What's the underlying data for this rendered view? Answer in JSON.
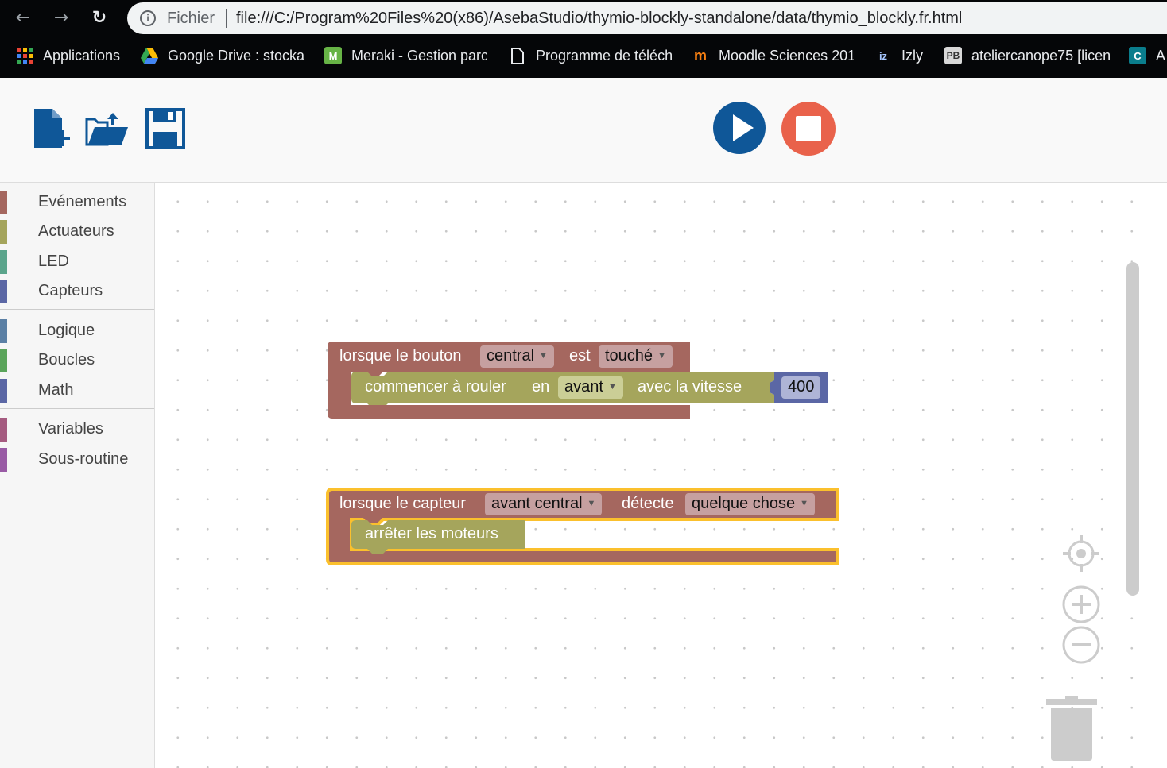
{
  "browser": {
    "scheme_label": "Fichier",
    "url": "file:///C:/Program%20Files%20(x86)/AsebaStudio/thymio-blockly-standalone/data/thymio_blockly.fr.html",
    "bookmarks": [
      {
        "label": "Applications",
        "icon": "apps-grid-icon"
      },
      {
        "label": "Google Drive : stocka",
        "icon": "google-drive-icon"
      },
      {
        "label": "Meraki - Gestion parc",
        "icon": "meraki-icon",
        "icon_text": "M"
      },
      {
        "label": "Programme de téléch",
        "icon": "page-icon"
      },
      {
        "label": "Moodle Sciences 201",
        "icon": "moodle-icon",
        "icon_text": "m"
      },
      {
        "label": "Izly",
        "icon": "izly-icon",
        "icon_text": "iz"
      },
      {
        "label": "ateliercanope75 [licen",
        "icon": "pb-icon",
        "icon_text": "PB"
      },
      {
        "label": "A",
        "icon": "c-icon",
        "icon_text": "C"
      }
    ]
  },
  "toolbar": {
    "new_icon": "new-file-icon",
    "open_icon": "open-folder-icon",
    "save_icon": "save-icon",
    "run_icon": "play-icon",
    "stop_icon": "stop-icon",
    "run_color": "#0f5798",
    "stop_color": "#e9624b"
  },
  "toolbox": {
    "categories": [
      {
        "label": "Evénements",
        "color": "#a5675f"
      },
      {
        "label": "Actuateurs",
        "color": "#a5a55c"
      },
      {
        "label": "LED",
        "color": "#5ba58c"
      },
      {
        "label": "Capteurs",
        "color": "#5b67a5"
      },
      {
        "label": "Logique",
        "color": "#5b80a5"
      },
      {
        "label": "Boucles",
        "color": "#5ba55b"
      },
      {
        "label": "Math",
        "color": "#5b67a5"
      },
      {
        "label": "Variables",
        "color": "#a55b80"
      },
      {
        "label": "Sous-routine",
        "color": "#995ba5"
      }
    ]
  },
  "blocks": {
    "event1": {
      "prefix": "lorsque le bouton",
      "button": "central",
      "mid": "est",
      "state": "touché",
      "color": "#a5675f",
      "action": {
        "prefix": "commencer à rouler",
        "mid": "en",
        "direction": "avant",
        "suffix": "avec la vitesse",
        "speed": "400",
        "color": "#a5a55c",
        "value_color": "#5b67a5"
      }
    },
    "event2": {
      "prefix": "lorsque le capteur",
      "sensor": "avant central",
      "mid": "détecte",
      "condition": "quelque chose",
      "color": "#a5675f",
      "highlight_color": "#fbc02d",
      "action": {
        "label": "arrêter les moteurs",
        "color": "#a5a55c"
      }
    }
  },
  "workspace_controls": {
    "center_icon": "recenter-icon",
    "zoom_in_icon": "zoom-in-icon",
    "zoom_out_icon": "zoom-out-icon",
    "trash_icon": "trash-icon"
  }
}
